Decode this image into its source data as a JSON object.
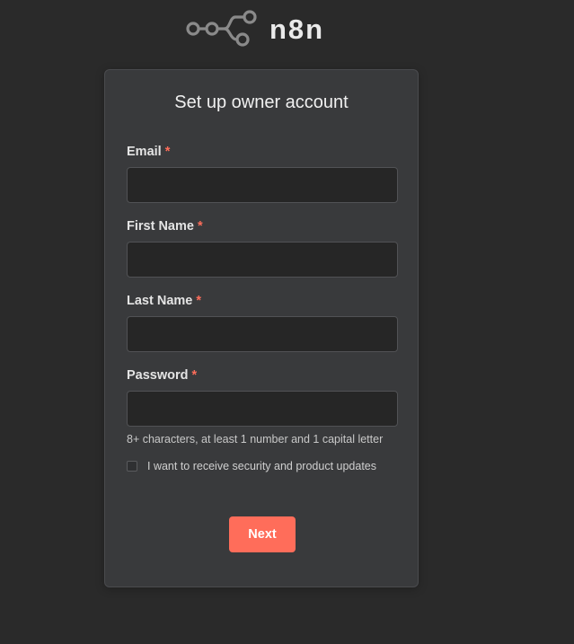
{
  "brand": {
    "name": "n8n",
    "logo_icon": "n8n-node-graph-icon",
    "accent_color": "#ff6d5a"
  },
  "form": {
    "title": "Set up owner account",
    "required_marker": "*",
    "fields": [
      {
        "label": "Email",
        "value": "",
        "placeholder": "",
        "type": "email"
      },
      {
        "label": "First Name",
        "value": "",
        "placeholder": "",
        "type": "text"
      },
      {
        "label": "Last Name",
        "value": "",
        "placeholder": "",
        "type": "text"
      },
      {
        "label": "Password",
        "value": "",
        "placeholder": "",
        "type": "password"
      }
    ],
    "password_hint": "8+ characters, at least 1 number and 1 capital letter",
    "updates_checkbox": {
      "label": "I want to receive security and product updates",
      "checked": false
    },
    "submit_label": "Next"
  }
}
